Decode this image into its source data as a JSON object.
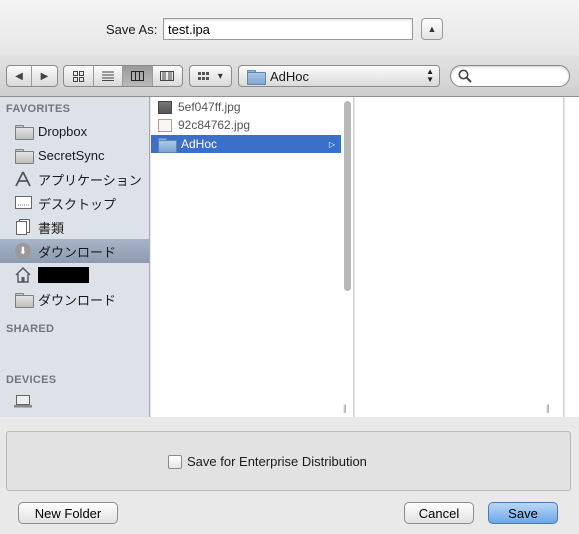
{
  "header": {
    "save_as_label": "Save As:",
    "filename": "test.ipa",
    "expand_glyph": "▲"
  },
  "toolbar": {
    "back_glyph": "◀",
    "forward_glyph": "▶",
    "arrange_glyph": "▾",
    "path_folder": "AdHoc",
    "search_placeholder": ""
  },
  "sidebar": {
    "favorites_title": "FAVORITES",
    "favorites": [
      {
        "label": "Dropbox",
        "icon": "folder-icon"
      },
      {
        "label": "SecretSync",
        "icon": "folder-icon"
      },
      {
        "label": "アプリケーション",
        "icon": "applications-icon"
      },
      {
        "label": "デスクトップ",
        "icon": "desktop-icon"
      },
      {
        "label": "書類",
        "icon": "documents-icon"
      },
      {
        "label": "ダウンロード",
        "icon": "downloads-icon",
        "selected": true
      },
      {
        "label": "",
        "icon": "home-icon",
        "redacted": true
      },
      {
        "label": "ダウンロード",
        "icon": "folder-icon"
      }
    ],
    "shared_title": "SHARED",
    "devices_title": "DEVICES"
  },
  "browser": {
    "column1": [
      {
        "name": "5ef047ff.jpg",
        "icon": "image-file-icon"
      },
      {
        "name": "92c84762.jpg",
        "icon": "image-file-icon"
      },
      {
        "name": "AdHoc",
        "icon": "folder-icon",
        "selected": true
      }
    ]
  },
  "footer": {
    "enterprise_label": "Save for Enterprise Distribution",
    "new_folder": "New Folder",
    "cancel": "Cancel",
    "save": "Save"
  },
  "colors": {
    "selection": "#3a70c9",
    "sidebar_bg": "#dde2e8",
    "default_button": "#6ea6ea"
  }
}
